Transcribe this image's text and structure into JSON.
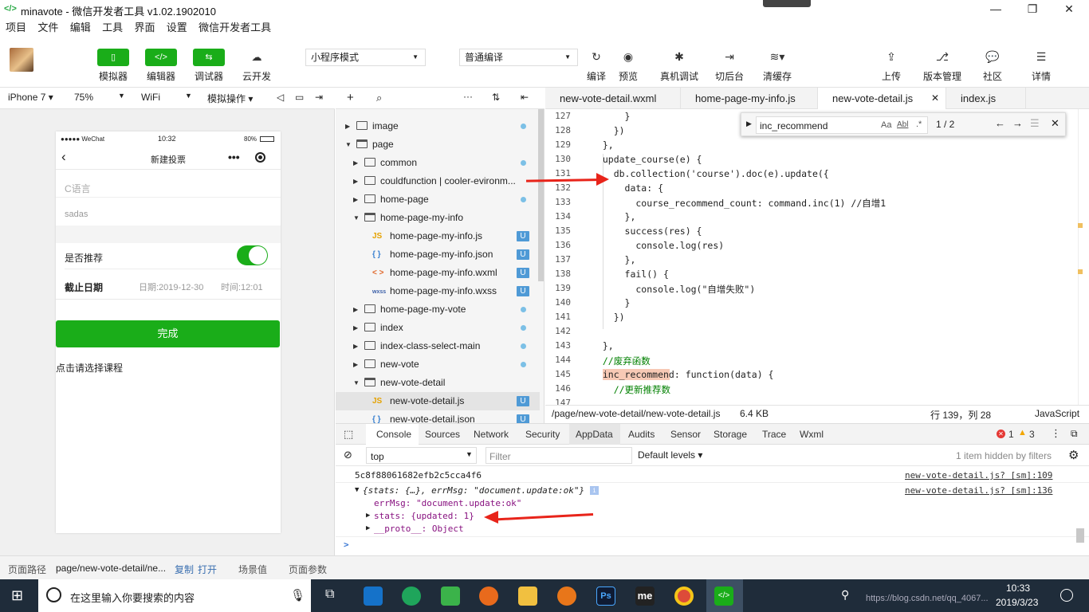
{
  "window": {
    "title": "minavote - 微信开发者工具 v1.02.1902010",
    "logo": "</>",
    "minimize": "—",
    "restore": "❐",
    "close": "✕"
  },
  "menu": [
    "项目",
    "文件",
    "编辑",
    "工具",
    "界面",
    "设置",
    "微信开发者工具"
  ],
  "toolbar": {
    "simulator": "模拟器",
    "editor": "编辑器",
    "debugger": "调试器",
    "cloud": "云开发",
    "mode": "小程序模式",
    "compile": "普通编译",
    "compile_btn": "编译",
    "preview": "预览",
    "remote_debug": "真机调试",
    "background": "切后台",
    "clear_cache": "清缓存",
    "upload": "上传",
    "version": "版本管理",
    "community": "社区",
    "details": "详情"
  },
  "simbar": {
    "device": "iPhone 7",
    "zoom": "75%",
    "network": "WiFi",
    "operation": "模拟操作"
  },
  "phone": {
    "carrier": "●●●●● WeChat",
    "time": "10:32",
    "battery": "80%",
    "nav_title": "新建投票",
    "field1_placeholder": "C语言",
    "field2_value": "sadas",
    "recommend_label": "是否推荐",
    "deadline_label": "截止日期",
    "date_value": "日期:2019-12-30",
    "time_value": "时间:12:01",
    "submit": "完成",
    "choose_course": "点击请选择课程"
  },
  "tree": [
    {
      "label": "image",
      "depth": 1,
      "type": "folder",
      "open": false,
      "mark": "dot"
    },
    {
      "label": "page",
      "depth": 1,
      "type": "folder",
      "open": true,
      "mark": ""
    },
    {
      "label": "common",
      "depth": 2,
      "type": "folder",
      "open": false,
      "mark": "dot"
    },
    {
      "label": "couldfunction | cooler-evironm...",
      "depth": 2,
      "type": "cloud",
      "open": false,
      "mark": ""
    },
    {
      "label": "home-page",
      "depth": 2,
      "type": "folder",
      "open": false,
      "mark": "dot"
    },
    {
      "label": "home-page-my-info",
      "depth": 2,
      "type": "folder",
      "open": true,
      "mark": ""
    },
    {
      "label": "home-page-my-info.js",
      "depth": 3,
      "type": "js",
      "mark": "U"
    },
    {
      "label": "home-page-my-info.json",
      "depth": 3,
      "type": "json",
      "mark": "U"
    },
    {
      "label": "home-page-my-info.wxml",
      "depth": 3,
      "type": "wxml",
      "mark": "U"
    },
    {
      "label": "home-page-my-info.wxss",
      "depth": 3,
      "type": "wxss",
      "mark": "U"
    },
    {
      "label": "home-page-my-vote",
      "depth": 2,
      "type": "folder",
      "open": false,
      "mark": "dot"
    },
    {
      "label": "index",
      "depth": 2,
      "type": "folder",
      "open": false,
      "mark": "dot"
    },
    {
      "label": "index-class-select-main",
      "depth": 2,
      "type": "folder",
      "open": false,
      "mark": "dot"
    },
    {
      "label": "new-vote",
      "depth": 2,
      "type": "folder",
      "open": false,
      "mark": "dot"
    },
    {
      "label": "new-vote-detail",
      "depth": 2,
      "type": "folder",
      "open": true,
      "mark": ""
    },
    {
      "label": "new-vote-detail.js",
      "depth": 3,
      "type": "js",
      "mark": "U",
      "selected": true
    },
    {
      "label": "new-vote-detail.json",
      "depth": 3,
      "type": "json",
      "mark": "U"
    }
  ],
  "tabs": [
    "new-vote-detail.wxml",
    "home-page-my-info.js",
    "new-vote-detail.js",
    "index.js"
  ],
  "code_lines": [
    {
      "n": "127",
      "t": "      }"
    },
    {
      "n": "128",
      "t": "    })"
    },
    {
      "n": "129",
      "t": "  },"
    },
    {
      "n": "130",
      "t": "  update_course(e) {"
    },
    {
      "n": "131",
      "t": "    db.collection('course').doc(e).update({"
    },
    {
      "n": "132",
      "t": "      data: {"
    },
    {
      "n": "133",
      "t": "        course_recommend_count: command.inc(1) //自增1"
    },
    {
      "n": "134",
      "t": "      },"
    },
    {
      "n": "135",
      "t": "      success(res) {"
    },
    {
      "n": "136",
      "t": "        console.log(res)"
    },
    {
      "n": "137",
      "t": "      },"
    },
    {
      "n": "138",
      "t": "      fail() {"
    },
    {
      "n": "139",
      "t": "        console.log(\"自增失败\")"
    },
    {
      "n": "140",
      "t": "      }"
    },
    {
      "n": "141",
      "t": "    })"
    },
    {
      "n": "142",
      "t": ""
    },
    {
      "n": "143",
      "t": "  },"
    },
    {
      "n": "144",
      "t": "  //废弃函数"
    },
    {
      "n": "145",
      "t": "  inc_recommend: function(data) {"
    },
    {
      "n": "146",
      "t": "    //更新推荐数"
    },
    {
      "n": "147",
      "t": ""
    }
  ],
  "find": {
    "query": "inc_recommend",
    "case": "Aa",
    "word": "Abl",
    "regex": ".*",
    "count": "1 / 2"
  },
  "status": {
    "path": "/page/new-vote-detail/new-vote-detail.js",
    "size": "6.4 KB",
    "cursor": "行 139，列 28",
    "lang": "JavaScript"
  },
  "devtools": {
    "tabs": [
      "Console",
      "Sources",
      "Network",
      "Security",
      "AppData",
      "Audits",
      "Sensor",
      "Storage",
      "Trace",
      "Wxml"
    ],
    "errors": "1",
    "warnings": "3",
    "context": "top",
    "filter_placeholder": "Filter",
    "levels": "Default levels",
    "hidden": "1 item hidden by filters"
  },
  "console": {
    "line1": "5c8f88061682efb2c5cca4f6",
    "line1_src": "new-vote-detail.js? [sm]:109",
    "line2": "{stats: {…}, errMsg: \"document.update:ok\"}",
    "line2_src": "new-vote-detail.js? [sm]:136",
    "errmsg": "errMsg: \"document.update:ok\"",
    "stats": "stats: {updated: 1}",
    "proto": "__proto__: Object",
    "prompt": ">"
  },
  "pathbar": {
    "label": "页面路径",
    "path": "page/new-vote-detail/ne...",
    "copy": "复制",
    "open": "打开",
    "scene": "场景值",
    "params": "页面参数"
  },
  "taskbar": {
    "search": "在这里输入你要搜索的内容",
    "time": "10:33",
    "date": "2019/3/23",
    "watermark": "https://blog.csdn.net/qq_4067..."
  },
  "colors": {
    "accent": "#1aad19",
    "arrow": "#e8241a",
    "taskbar": "#1f2c3a"
  }
}
